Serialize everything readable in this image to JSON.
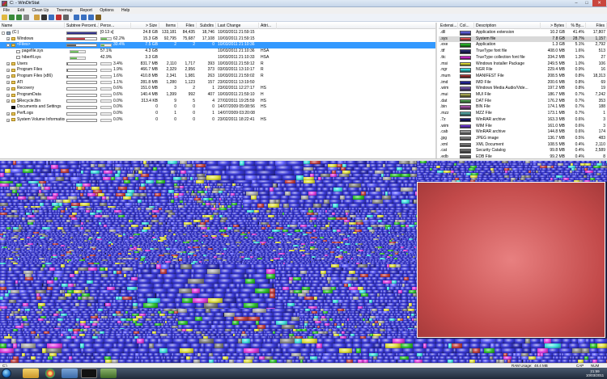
{
  "window": {
    "title": "C: - WinDirStat",
    "minimize": "‒",
    "maximize": "□",
    "close": "✕"
  },
  "menu": [
    "File",
    "Edit",
    "Clean Up",
    "Treemap",
    "Report",
    "Options",
    "Help"
  ],
  "toolbar": {
    "buttons": [
      "open-icon",
      "refresh-icon",
      "refresh-all-icon",
      "copy-path-icon",
      "explorer-icon",
      "cmd-icon",
      "recycle-icon",
      "delete-icon",
      "properties-icon",
      "zoom-in-icon",
      "zoom-out-icon",
      "up-icon",
      "help-icon"
    ]
  },
  "tree": {
    "headers": [
      "Name",
      "Subtree Percent...",
      "Perce...",
      "> Size",
      "Items",
      "Files",
      "Subdirs",
      "Last Change",
      "Attri..."
    ],
    "rows": [
      {
        "indent": 0,
        "expander": "-",
        "icon": "drive",
        "name": "(C:)",
        "sub": 1.0,
        "perc": "[0:13 s]",
        "size": "24.8 GB",
        "items": "133,181",
        "files": "84,435",
        "subdirs": "18,746",
        "last": "10/03/2011  21:59:15",
        "attr": ""
      },
      {
        "indent": 1,
        "expander": "+",
        "icon": "folder",
        "name": "Windows",
        "sub": 0.62,
        "perc": "62.2%",
        "size": "15.3 GB",
        "items": "92,795",
        "files": "75,687",
        "subdirs": "17,108",
        "last": "10/03/2011  21:59:15",
        "attr": ""
      },
      {
        "indent": 1,
        "expander": "-",
        "icon": "folder",
        "name": "<Files>",
        "sub": 0.3,
        "perc": "30.4%",
        "size": "7.5 GB",
        "items": "2",
        "files": "2",
        "subdirs": "0",
        "last": "10/03/2011  21:10:36",
        "attr": "",
        "selected": true
      },
      {
        "indent": 2,
        "expander": "",
        "icon": "file",
        "name": "pagefile.sys",
        "sub": 0.57,
        "perc": "57.1%",
        "size": "4.3 GB",
        "items": "",
        "files": "",
        "subdirs": "",
        "last": "10/03/2011  21:10:36",
        "attr": "HSA",
        "green": true
      },
      {
        "indent": 2,
        "expander": "",
        "icon": "file",
        "name": "hiberfil.sys",
        "sub": 0.43,
        "perc": "42.9%",
        "size": "3.3 GB",
        "items": "",
        "files": "",
        "subdirs": "",
        "last": "10/03/2011  21:10:33",
        "attr": "HSA",
        "green": true
      },
      {
        "indent": 1,
        "expander": "+",
        "icon": "folder",
        "name": "Users",
        "sub": 0.034,
        "perc": "3.4%",
        "size": "831.7 MB",
        "items": "2,110",
        "files": "1,717",
        "subdirs": "393",
        "last": "10/03/2011  21:59:12",
        "attr": "R"
      },
      {
        "indent": 1,
        "expander": "+",
        "icon": "folder",
        "name": "Program Files",
        "sub": 0.019,
        "perc": "1.9%",
        "size": "466.7 MB",
        "items": "2,329",
        "files": "2,956",
        "subdirs": "373",
        "last": "03/03/2011  13:10:17",
        "attr": "R"
      },
      {
        "indent": 1,
        "expander": "+",
        "icon": "folder",
        "name": "Program Files (x86)",
        "sub": 0.016,
        "perc": "1.6%",
        "size": "410.8 MB",
        "items": "2,341",
        "files": "1,981",
        "subdirs": "263",
        "last": "10/03/2011  21:59:02",
        "attr": "R"
      },
      {
        "indent": 1,
        "expander": "+",
        "icon": "folder",
        "name": "ATI",
        "sub": 0.011,
        "perc": "1.1%",
        "size": "281.8 MB",
        "items": "1,280",
        "files": "1,123",
        "subdirs": "157",
        "last": "23/02/2011  13:19:50",
        "attr": ""
      },
      {
        "indent": 1,
        "expander": "+",
        "icon": "folder",
        "name": "Recovery",
        "sub": 0.006,
        "perc": "0.6%",
        "size": "151.0 MB",
        "items": "3",
        "files": "2",
        "subdirs": "1",
        "last": "23/02/2011  12:27:17",
        "attr": "HS"
      },
      {
        "indent": 1,
        "expander": "+",
        "icon": "folder",
        "name": "ProgramData",
        "sub": 0.006,
        "perc": "0.6%",
        "size": "140.4 MB",
        "items": "1,399",
        "files": "992",
        "subdirs": "407",
        "last": "10/03/2011  21:59:10",
        "attr": "H"
      },
      {
        "indent": 1,
        "expander": "+",
        "icon": "folder",
        "name": "$Recycle.Bin",
        "sub": 0.001,
        "perc": "0.0%",
        "size": "313.4 KB",
        "items": "9",
        "files": "5",
        "subdirs": "4",
        "last": "27/02/2011  19:25:59",
        "attr": "HS"
      },
      {
        "indent": 1,
        "expander": "",
        "icon": "black",
        "name": "Documents and Settings",
        "sub": 0.0,
        "perc": "0.0%",
        "size": "0",
        "items": "0",
        "files": "0",
        "subdirs": "0",
        "last": "14/07/2009  05:08:56",
        "attr": "HS"
      },
      {
        "indent": 1,
        "expander": "+",
        "icon": "folder",
        "name": "PerfLogs",
        "sub": 0.0,
        "perc": "0.0%",
        "size": "0",
        "items": "1",
        "files": "0",
        "subdirs": "1",
        "last": "14/07/2009  03:20:08",
        "attr": ""
      },
      {
        "indent": 1,
        "expander": "+",
        "icon": "folder",
        "name": "System Volume Information",
        "sub": 0.0,
        "perc": "0.0%",
        "size": "0",
        "items": "0",
        "files": "0",
        "subdirs": "0",
        "last": "23/02/2011  18:22:41",
        "attr": "HS"
      }
    ]
  },
  "extensions": {
    "headers": [
      "Extensi...",
      "Col...",
      "Description",
      "> Bytes",
      "% By...",
      "Files"
    ],
    "rows": [
      {
        "ext": ".dll",
        "color": "#7070ff",
        "desc": "Application extension",
        "bytes": "10.2 GB",
        "pct": "41.4%",
        "files": "17,807"
      },
      {
        "ext": ".sys",
        "color": "#ff6060",
        "desc": "System file",
        "bytes": "7.8 GB",
        "pct": "28.7%",
        "files": "1,157",
        "selected": true
      },
      {
        "ext": ".exe",
        "color": "#30d030",
        "desc": "Application",
        "bytes": "1.3 GB",
        "pct": "5.1%",
        "files": "2,792"
      },
      {
        "ext": ".ttf",
        "color": "#303080",
        "desc": "TrueType font file",
        "bytes": "408.0 MB",
        "pct": "1.6%",
        "files": "513"
      },
      {
        "ext": ".ttc",
        "color": "#ff30ff",
        "desc": "TrueType collection font file",
        "bytes": "334.2 MB",
        "pct": "1.3%",
        "files": "27"
      },
      {
        "ext": ".msi",
        "color": "#ffff40",
        "desc": "Windows Installer Package",
        "bytes": "249.5 MB",
        "pct": "1.0%",
        "files": "106"
      },
      {
        "ext": ".ngr",
        "color": "#40ffff",
        "desc": "NGR File",
        "bytes": "229.4 MB",
        "pct": "0.9%",
        "files": "16"
      },
      {
        "ext": ".mum",
        "color": "#c04040",
        "desc": "MANIFEST File",
        "bytes": "208.5 MB",
        "pct": "0.8%",
        "files": "18,313"
      },
      {
        "ext": ".imd",
        "color": "#3030c0",
        "desc": "IMD File",
        "bytes": "200.6 MB",
        "pct": "0.8%",
        "files": "69"
      },
      {
        "ext": ".wim",
        "color": "#8060c0",
        "desc": "Windows Media Audio/Vide...",
        "bytes": "197.2 MB",
        "pct": "0.8%",
        "files": "19"
      },
      {
        "ext": ".mui",
        "color": "#c0c060",
        "desc": "MUI File",
        "bytes": "186.7 MB",
        "pct": "0.7%",
        "files": "7,242"
      },
      {
        "ext": ".dat",
        "color": "#60c060",
        "desc": "DAT File",
        "bytes": "176.2 MB",
        "pct": "0.7%",
        "files": "353"
      },
      {
        "ext": ".bin",
        "color": "#c060c0",
        "desc": "BIN File",
        "bytes": "174.1 MB",
        "pct": "0.7%",
        "files": "188"
      },
      {
        "ext": ".mzz",
        "color": "#60c0c0",
        "desc": "MZZ File",
        "bytes": "173.1 MB",
        "pct": "0.7%",
        "files": "1"
      },
      {
        "ext": ".7z",
        "color": "#202080",
        "desc": "WinRAR archive",
        "bytes": "163.3 MB",
        "pct": "0.6%",
        "files": "3"
      },
      {
        "ext": ".wim",
        "color": "#8040ff",
        "desc": "WIM File",
        "bytes": "161.0 MB",
        "pct": "0.6%",
        "files": "3"
      },
      {
        "ext": ".cab",
        "color": "#b0b0b0",
        "desc": "WinRAR archive",
        "bytes": "144.8 MB",
        "pct": "0.6%",
        "files": "174"
      },
      {
        "ext": ".jpg",
        "color": "#a0a0a0",
        "desc": "JPEG image",
        "bytes": "136.7 MB",
        "pct": "0.5%",
        "files": "483"
      },
      {
        "ext": ".xml",
        "color": "#909090",
        "desc": "XML Document",
        "bytes": "108.5 MB",
        "pct": "0.4%",
        "files": "2,110"
      },
      {
        "ext": ".cat",
        "color": "#808080",
        "desc": "Security Catalog",
        "bytes": "99.8 MB",
        "pct": "0.4%",
        "files": "2,589"
      },
      {
        "ext": ".edb",
        "color": "#707070",
        "desc": "EDB File",
        "bytes": "99.2 MB",
        "pct": "0.4%",
        "files": "8"
      }
    ]
  },
  "status": {
    "path": "C:\\",
    "ram_label": "RAM Usage:",
    "ram_value": "48.4 MB",
    "caps": "CAP",
    "num": "NUM"
  },
  "taskbar": {
    "time": "21:59",
    "date": "10/03/2011"
  }
}
